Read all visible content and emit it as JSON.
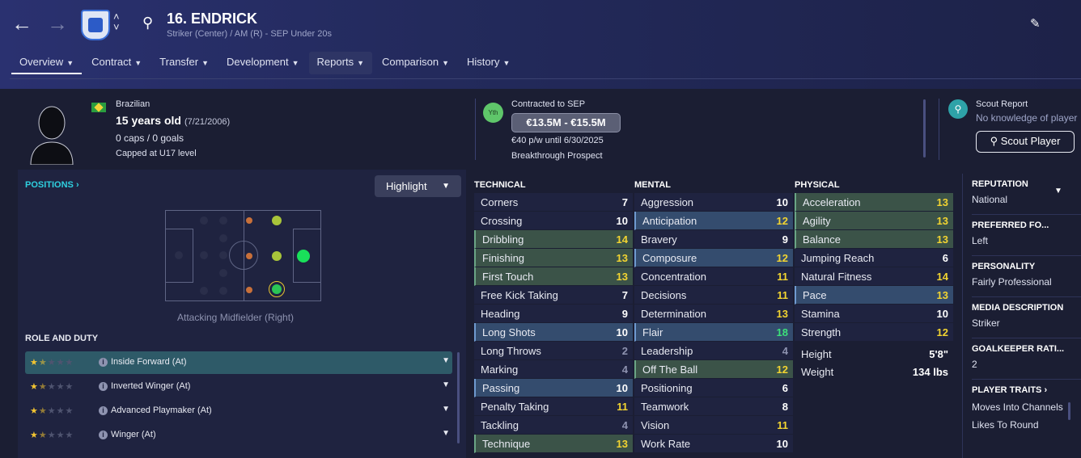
{
  "header": {
    "back_icon": "arrow-left-icon",
    "forward_icon": "arrow-right-icon",
    "player_name": "16. ENDRICK",
    "subtitle": "Striker (Center) / AM (R) - SEP Under 20s",
    "tabs": [
      {
        "label": "Overview"
      },
      {
        "label": "Contract"
      },
      {
        "label": "Transfer"
      },
      {
        "label": "Development"
      },
      {
        "label": "Reports"
      },
      {
        "label": "Comparison"
      },
      {
        "label": "History"
      }
    ]
  },
  "bio": {
    "nationality": "Brazilian",
    "age": "15 years old",
    "dob": "(7/21/2006)",
    "caps": "0 caps / 0 goals",
    "capped": "Capped at U17 level"
  },
  "contract": {
    "badge": "Yth",
    "label": "Contracted to SEP",
    "value": "€13.5M - €15.5M",
    "wage": "€40 p/w until 6/30/2025",
    "prospect": "Breakthrough Prospect"
  },
  "scout": {
    "title": "Scout Report",
    "knowledge": "No knowledge of player",
    "button": "Scout Player"
  },
  "positions": {
    "header": "POSITIONS",
    "highlight": "Highlight",
    "label": "Attacking Midfielder (Right)"
  },
  "roles": {
    "header": "ROLE AND DUTY",
    "items": [
      {
        "name": "Inside Forward (At)",
        "stars": 1.5
      },
      {
        "name": "Inverted Winger (At)",
        "stars": 1.5
      },
      {
        "name": "Advanced Playmaker (At)",
        "stars": 1.5
      },
      {
        "name": "Winger (At)",
        "stars": 1.5
      }
    ]
  },
  "technical": {
    "header": "TECHNICAL",
    "rows": [
      {
        "name": "Corners",
        "value": "7"
      },
      {
        "name": "Crossing",
        "value": "10"
      },
      {
        "name": "Dribbling",
        "value": "14"
      },
      {
        "name": "Finishing",
        "value": "13"
      },
      {
        "name": "First Touch",
        "value": "13"
      },
      {
        "name": "Free Kick Taking",
        "value": "7"
      },
      {
        "name": "Heading",
        "value": "9"
      },
      {
        "name": "Long Shots",
        "value": "10"
      },
      {
        "name": "Long Throws",
        "value": "2"
      },
      {
        "name": "Marking",
        "value": "4"
      },
      {
        "name": "Passing",
        "value": "10"
      },
      {
        "name": "Penalty Taking",
        "value": "11"
      },
      {
        "name": "Tackling",
        "value": "4"
      },
      {
        "name": "Technique",
        "value": "13"
      }
    ]
  },
  "mental": {
    "header": "MENTAL",
    "rows": [
      {
        "name": "Aggression",
        "value": "10"
      },
      {
        "name": "Anticipation",
        "value": "12"
      },
      {
        "name": "Bravery",
        "value": "9"
      },
      {
        "name": "Composure",
        "value": "12"
      },
      {
        "name": "Concentration",
        "value": "11"
      },
      {
        "name": "Decisions",
        "value": "11"
      },
      {
        "name": "Determination",
        "value": "13"
      },
      {
        "name": "Flair",
        "value": "18"
      },
      {
        "name": "Leadership",
        "value": "4"
      },
      {
        "name": "Off The Ball",
        "value": "12"
      },
      {
        "name": "Positioning",
        "value": "6"
      },
      {
        "name": "Teamwork",
        "value": "8"
      },
      {
        "name": "Vision",
        "value": "11"
      },
      {
        "name": "Work Rate",
        "value": "10"
      }
    ]
  },
  "physical": {
    "header": "PHYSICAL",
    "rows": [
      {
        "name": "Acceleration",
        "value": "13"
      },
      {
        "name": "Agility",
        "value": "13"
      },
      {
        "name": "Balance",
        "value": "13"
      },
      {
        "name": "Jumping Reach",
        "value": "6"
      },
      {
        "name": "Natural Fitness",
        "value": "14"
      },
      {
        "name": "Pace",
        "value": "13"
      },
      {
        "name": "Stamina",
        "value": "10"
      },
      {
        "name": "Strength",
        "value": "12"
      }
    ],
    "height_label": "Height",
    "height": "5'8\"",
    "weight_label": "Weight",
    "weight": "134 lbs"
  },
  "info": {
    "reputation_label": "REPUTATION",
    "reputation": "National",
    "foot_label": "PREFERRED FO...",
    "foot": "Left",
    "personality_label": "PERSONALITY",
    "personality": "Fairly Professional",
    "media_label": "MEDIA DESCRIPTION",
    "media": "Striker",
    "gk_label": "GOALKEEPER RATI...",
    "gk": "2",
    "traits_label": "PLAYER TRAITS",
    "traits": [
      "Moves Into Channels",
      "Likes To Round"
    ]
  },
  "colors": {
    "header_bg": "#2a3170",
    "body_bg": "#1b1e33",
    "good_highlight": "#3b5348",
    "key_highlight": "#344c6e",
    "value_yellow": "#f2d431",
    "value_green": "#3de07a",
    "accent_cyan": "#2fd0e0",
    "star": "#f2c431"
  }
}
